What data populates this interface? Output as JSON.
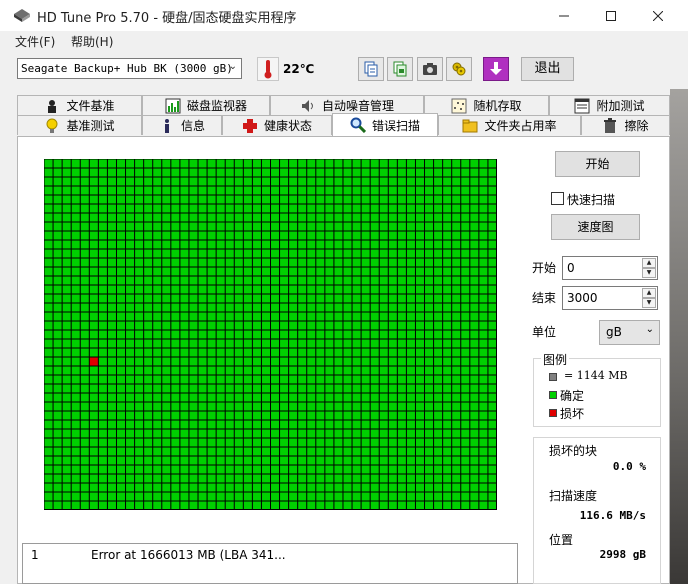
{
  "window": {
    "title": "HD Tune Pro 5.70 - 硬盘/固态硬盘实用程序",
    "controls": [
      "minimize-icon",
      "maximize-icon",
      "close-icon"
    ]
  },
  "menu": {
    "items": [
      "文件(F)",
      "帮助(H)"
    ]
  },
  "toolbar": {
    "drive": "Seagate Backup+ Hub BK (3000 gB)",
    "temperature": "22℃",
    "icon_buttons": [
      "copy-info-icon",
      "copy-screenshot-icon",
      "camera-icon",
      "options-icon",
      "download-icon"
    ],
    "exit_label": "退出"
  },
  "tabs_row1": [
    {
      "label": "文件基准",
      "icon": "file-benchmark-icon"
    },
    {
      "label": "磁盘监视器",
      "icon": "disk-monitor-icon"
    },
    {
      "label": "自动噪音管理",
      "icon": "speaker-icon"
    },
    {
      "label": "随机存取",
      "icon": "random-access-icon"
    },
    {
      "label": "附加测试",
      "icon": "extra-tests-icon"
    }
  ],
  "tabs_row2": [
    {
      "label": "基准测试",
      "icon": "lightbulb-icon"
    },
    {
      "label": "信息",
      "icon": "info-icon"
    },
    {
      "label": "健康状态",
      "icon": "health-cross-icon"
    },
    {
      "label": "错误扫描",
      "icon": "magnifier-icon",
      "active": true
    },
    {
      "label": "文件夹占用率",
      "icon": "folder-icon"
    },
    {
      "label": "擦除",
      "icon": "trash-icon"
    }
  ],
  "scan": {
    "columns": 50,
    "rows": 39,
    "colors": {
      "ok": "#00d000",
      "damaged": "#e00000",
      "grid_line": "#000000"
    },
    "damaged_blocks": [
      {
        "row": 22,
        "col": 5
      }
    ]
  },
  "controls": {
    "start_label": "开始",
    "quick_scan_label": "快速扫描",
    "quick_scan_checked": false,
    "speed_map_label": "速度图",
    "start_field_label": "开始",
    "start_value": "0",
    "end_field_label": "结束",
    "end_value": "3000",
    "unit_label": "单位",
    "unit_value": "gB"
  },
  "legend": {
    "title": "图例",
    "block_size": "= 1144 MB",
    "ok_label": "确定",
    "damaged_label": "损坏",
    "block_color": "#808080",
    "ok_color": "#00d000",
    "damaged_color": "#e00000"
  },
  "stats": {
    "damaged_blocks_label": "损坏的块",
    "damaged_blocks_value": "0.0 %",
    "scan_speed_label": "扫描速度",
    "scan_speed_value": "116.6 MB/s",
    "position_label": "位置",
    "position_value": "2998 gB"
  },
  "log": [
    {
      "index": "1",
      "message": "Error at 1666013 MB (LBA 341..."
    }
  ]
}
